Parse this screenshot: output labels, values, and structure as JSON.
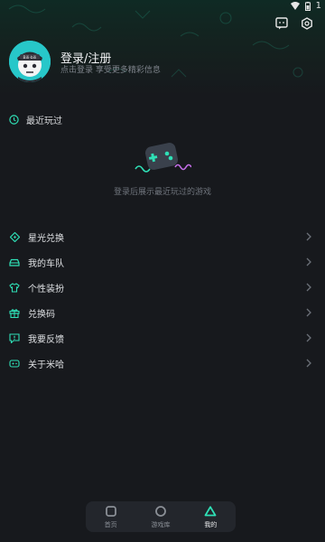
{
  "status": {
    "battery_level": "1"
  },
  "header": {
    "message_icon": "chat-square-icon",
    "settings_icon": "hexagon-gear-icon"
  },
  "profile": {
    "title": "登录/注册",
    "subtitle": "点击登录 享受更多精彩信息",
    "avatar_text": "Bili·bili"
  },
  "recent": {
    "label": "最近玩过",
    "empty_text": "登录后展示最近玩过的游戏"
  },
  "menu": {
    "items": [
      {
        "label": "星光兑换",
        "icon": "star-diamond-icon"
      },
      {
        "label": "我的车队",
        "icon": "car-icon"
      },
      {
        "label": "个性装扮",
        "icon": "shirt-icon"
      },
      {
        "label": "兑换码",
        "icon": "gift-icon"
      },
      {
        "label": "我要反馈",
        "icon": "feedback-icon"
      },
      {
        "label": "关于米哈",
        "icon": "gamepad-icon"
      }
    ]
  },
  "tabbar": {
    "tabs": [
      {
        "label": "首页",
        "icon": "home-square-icon",
        "active": false
      },
      {
        "label": "游戏库",
        "icon": "circle-icon",
        "active": false
      },
      {
        "label": "我的",
        "icon": "triangle-icon",
        "active": true
      }
    ]
  },
  "colors": {
    "accent": "#2fe0b6",
    "background": "#17191d",
    "tab_bg": "#23262c"
  }
}
